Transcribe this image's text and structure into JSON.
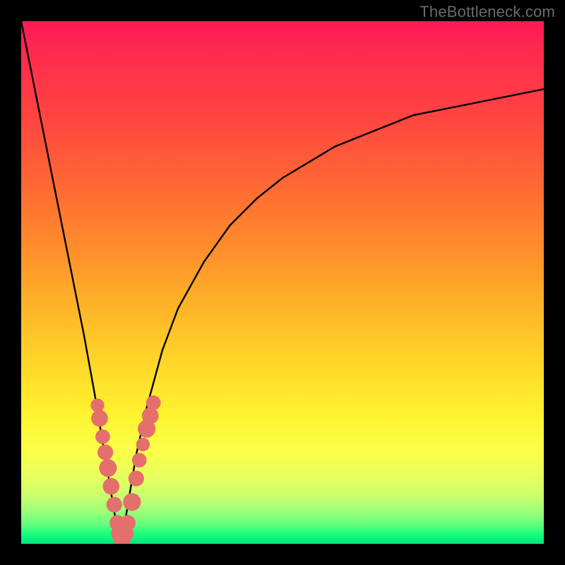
{
  "watermark": "TheBottleneck.com",
  "colors": {
    "marker": "#e46f6c",
    "curve_stroke": "#000000",
    "gradient_top": "#ff1955",
    "gradient_bottom": "#00e77c"
  },
  "chart_data": {
    "type": "line",
    "title": "",
    "xlabel": "",
    "ylabel": "",
    "xlim": [
      0,
      100
    ],
    "ylim": [
      0,
      100
    ],
    "notes": "V-shaped bottleneck curve. x is a generic index (0–100), y is bottleneck percentage (0 = no bottleneck, 100 = max). Minimum at x≈19 where y≈0. Left branch is steep and near-linear; right branch rises asymptotically toward ~87% by x=100.",
    "series": [
      {
        "name": "bottleneck-curve",
        "x": [
          0,
          3,
          6,
          9,
          12,
          14,
          16,
          17,
          18,
          18.5,
          19,
          19.5,
          20,
          21,
          22,
          24,
          27,
          30,
          35,
          40,
          45,
          50,
          55,
          60,
          65,
          70,
          75,
          80,
          85,
          90,
          95,
          100
        ],
        "y": [
          100,
          85,
          70,
          55,
          40,
          29,
          17,
          11,
          5,
          2,
          0,
          2,
          5,
          11,
          17,
          26,
          37,
          45,
          54,
          61,
          66,
          70,
          73,
          76,
          78,
          80,
          82,
          83,
          84,
          85,
          86,
          87
        ]
      }
    ],
    "markers": [
      {
        "name": "left-branch-marker",
        "x": 14.6,
        "y": 26.5,
        "r": 1.3
      },
      {
        "name": "left-branch-marker",
        "x": 15.0,
        "y": 24.0,
        "r": 1.6
      },
      {
        "name": "left-branch-marker",
        "x": 15.6,
        "y": 20.5,
        "r": 1.4
      },
      {
        "name": "left-branch-marker",
        "x": 16.1,
        "y": 17.5,
        "r": 1.5
      },
      {
        "name": "left-branch-marker",
        "x": 16.6,
        "y": 14.5,
        "r": 1.7
      },
      {
        "name": "left-branch-marker",
        "x": 17.2,
        "y": 11.0,
        "r": 1.6
      },
      {
        "name": "left-branch-marker",
        "x": 17.8,
        "y": 7.5,
        "r": 1.5
      },
      {
        "name": "bottom-marker",
        "x": 18.4,
        "y": 4.0,
        "r": 1.5
      },
      {
        "name": "bottom-marker",
        "x": 18.8,
        "y": 2.0,
        "r": 1.6
      },
      {
        "name": "bottom-marker",
        "x": 19.3,
        "y": 1.0,
        "r": 1.7
      },
      {
        "name": "bottom-marker",
        "x": 19.9,
        "y": 2.0,
        "r": 1.6
      },
      {
        "name": "bottom-marker",
        "x": 20.4,
        "y": 4.0,
        "r": 1.5
      },
      {
        "name": "right-branch-marker",
        "x": 21.2,
        "y": 8.0,
        "r": 1.7
      },
      {
        "name": "right-branch-marker",
        "x": 22.0,
        "y": 12.5,
        "r": 1.5
      },
      {
        "name": "right-branch-marker",
        "x": 22.6,
        "y": 16.0,
        "r": 1.4
      },
      {
        "name": "right-branch-marker",
        "x": 23.3,
        "y": 19.0,
        "r": 1.3
      },
      {
        "name": "right-branch-marker",
        "x": 24.0,
        "y": 22.0,
        "r": 1.7
      },
      {
        "name": "right-branch-marker",
        "x": 24.7,
        "y": 24.5,
        "r": 1.6
      },
      {
        "name": "right-branch-marker",
        "x": 25.3,
        "y": 27.0,
        "r": 1.4
      }
    ]
  }
}
